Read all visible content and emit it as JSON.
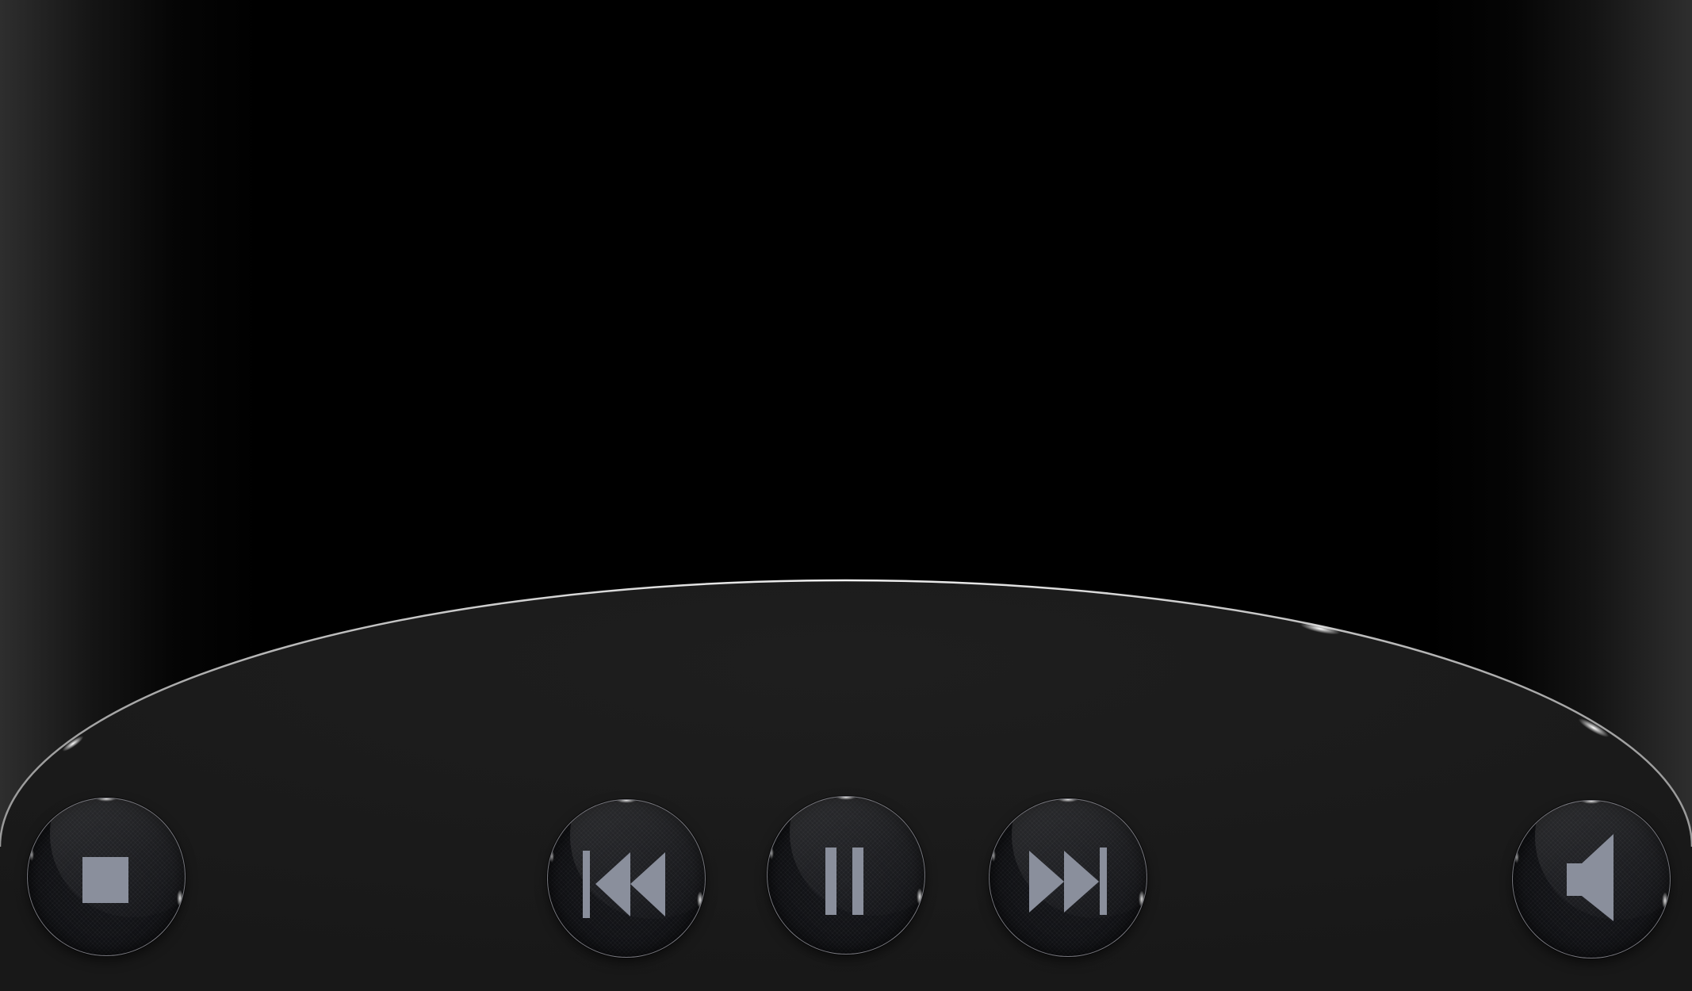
{
  "player": {
    "colors": {
      "background": "#000000",
      "panel": "#1b1b1b",
      "panel_edge": "#e6e6e6",
      "button_face": "#15161a",
      "icon": "#8a8f9c"
    },
    "controls": [
      {
        "name": "stop-button",
        "icon": "stop-icon"
      },
      {
        "name": "rewind-button",
        "icon": "skip-back-icon"
      },
      {
        "name": "pause-button",
        "icon": "pause-icon"
      },
      {
        "name": "fast-forward-button",
        "icon": "skip-forward-icon"
      },
      {
        "name": "volume-button",
        "icon": "speaker-icon"
      }
    ]
  }
}
